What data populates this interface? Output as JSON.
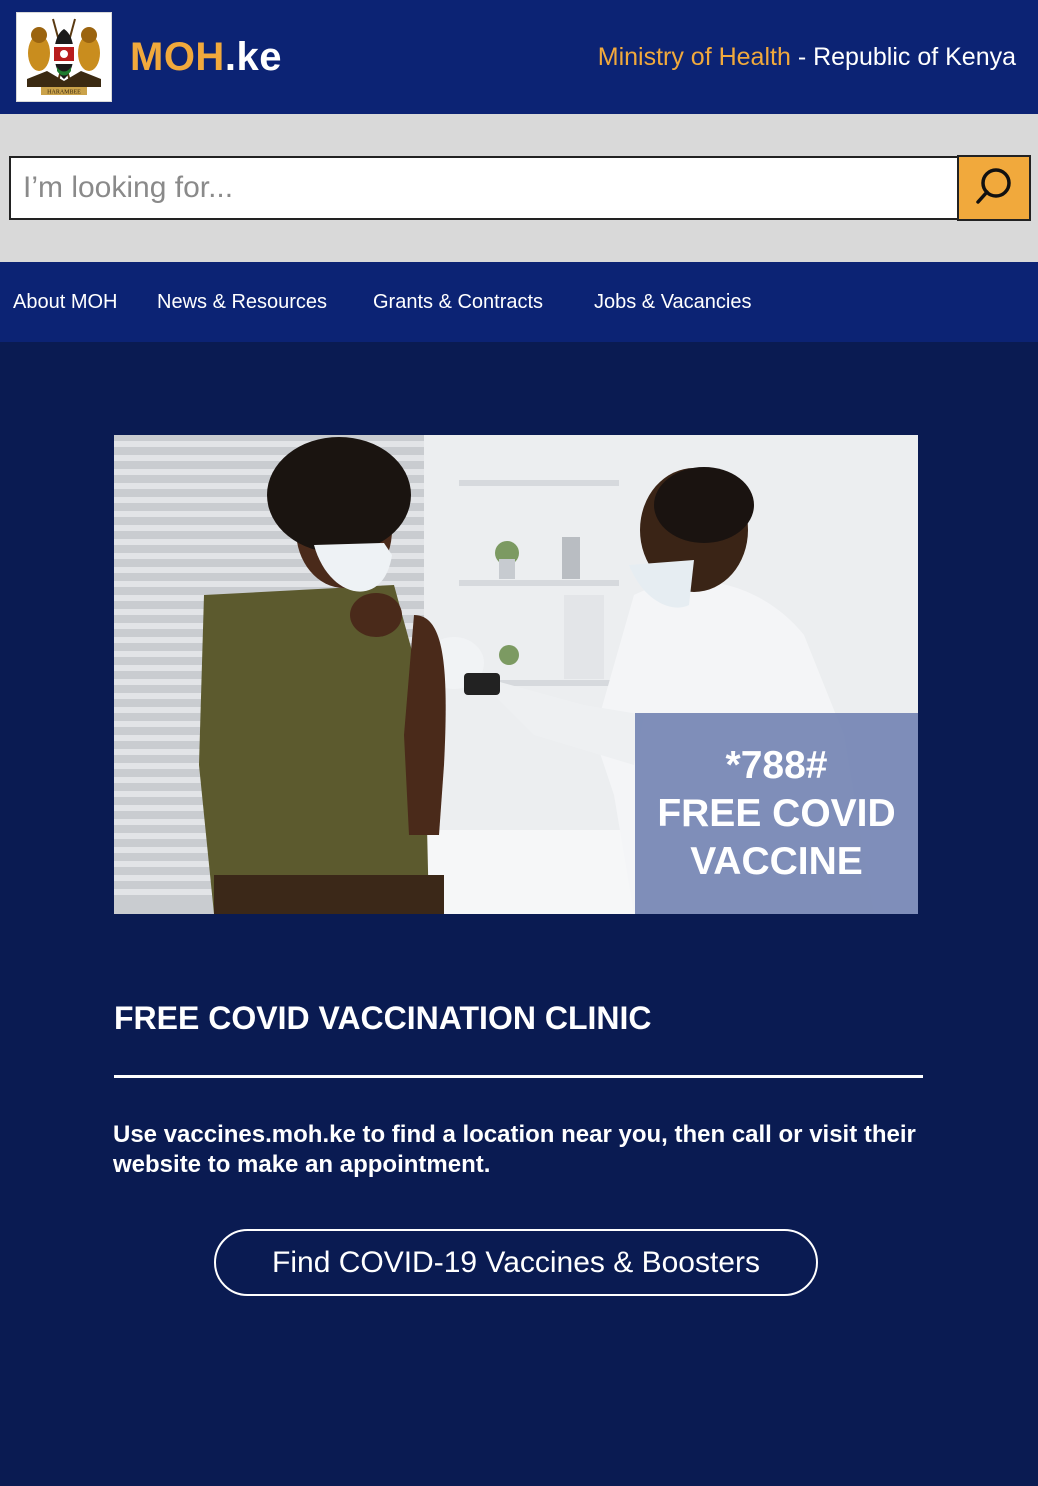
{
  "header": {
    "brand_primary": "MOH",
    "brand_suffix": ".ke",
    "ministry_label": "Ministry of Health",
    "separator": " - ",
    "republic_label": "Republic of Kenya",
    "logo_icon": "kenya-coat-of-arms-icon",
    "logo_motto": "HARAMBEE"
  },
  "search": {
    "placeholder": "I’m looking for...",
    "value": "",
    "button_icon": "search-icon"
  },
  "nav": {
    "items": [
      {
        "label": "About MOH"
      },
      {
        "label": "News & Resources"
      },
      {
        "label": "Grants & Contracts"
      },
      {
        "label": "Jobs & Vacancies"
      }
    ]
  },
  "hero": {
    "image_icon": "vaccination-photo",
    "promo_lines": [
      "*788#",
      "FREE COVID",
      "VACCINE"
    ]
  },
  "clinic": {
    "title": "FREE COVID VACCINATION CLINIC",
    "description": "Use vaccines.moh.ke to find a location near you, then call or visit their website to make an appointment.",
    "cta_label": "Find COVID-19 Vaccines & Boosters"
  },
  "colors": {
    "header_bg": "#0c2374",
    "page_bg": "#0a1b52",
    "accent": "#f1a93c",
    "search_band": "#d9d9d9"
  }
}
